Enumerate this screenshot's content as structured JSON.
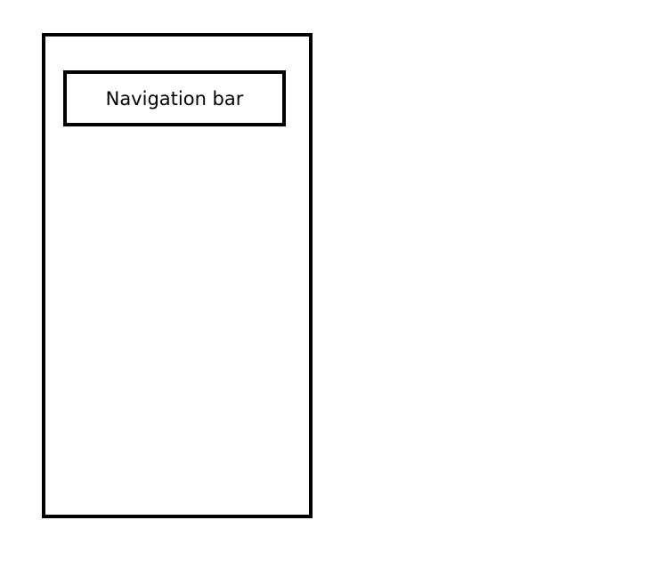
{
  "diagram": {
    "nav_bar": {
      "label": "Navigation bar"
    },
    "colors": {
      "stroke": "#000000",
      "background": "#ffffff"
    }
  }
}
